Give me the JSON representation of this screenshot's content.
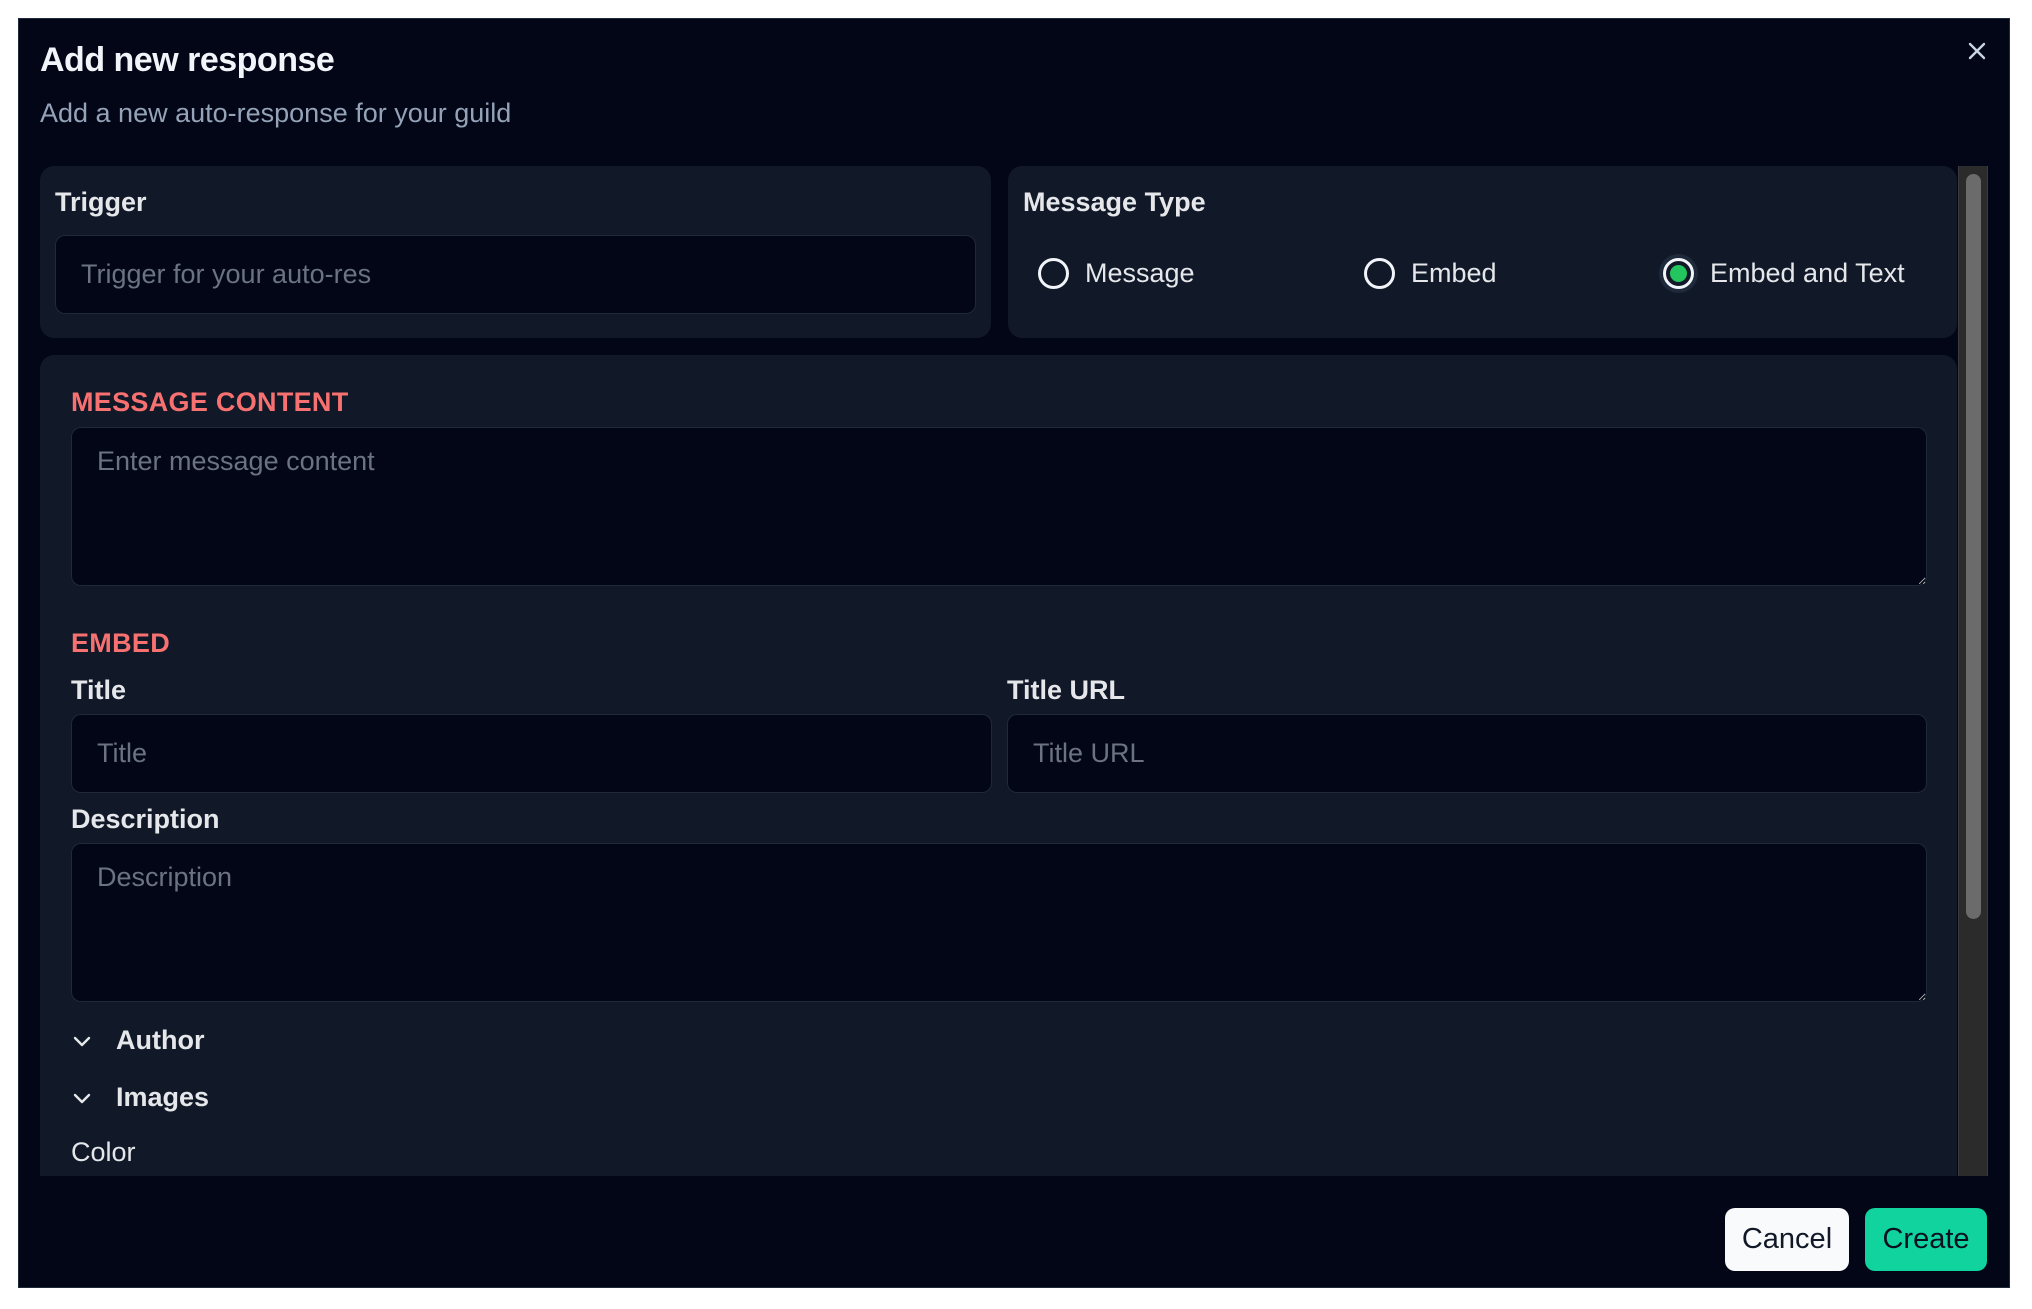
{
  "dialog": {
    "title": "Add new response",
    "subtitle": "Add a new auto-response for your guild",
    "close_icon": "close-icon"
  },
  "trigger": {
    "label": "Trigger",
    "placeholder": "Trigger for your auto-res",
    "value": ""
  },
  "message_type": {
    "label": "Message Type",
    "options": [
      {
        "label": "Message",
        "checked": false
      },
      {
        "label": "Embed",
        "checked": false
      },
      {
        "label": "Embed and Text",
        "checked": true
      }
    ],
    "selected": "Embed and Text"
  },
  "message_content": {
    "heading": "MESSAGE CONTENT",
    "placeholder": "Enter message content",
    "value": ""
  },
  "embed": {
    "heading": "EMBED",
    "title": {
      "label": "Title",
      "placeholder": "Title",
      "value": ""
    },
    "title_url": {
      "label": "Title URL",
      "placeholder": "Title URL",
      "value": ""
    },
    "description": {
      "label": "Description",
      "placeholder": "Description",
      "value": ""
    },
    "author": {
      "label": "Author",
      "icon": "chevron-down-icon"
    },
    "images": {
      "label": "Images",
      "icon": "chevron-down-icon"
    },
    "color": {
      "label": "Color"
    }
  },
  "footer": {
    "cancel_label": "Cancel",
    "create_label": "Create"
  },
  "colors": {
    "background": "#020617",
    "card": "#111827",
    "section_heading": "#f87171",
    "radio_selected": "#22c55e",
    "create_button": "#10d39e",
    "cancel_button": "#f8fafc"
  }
}
